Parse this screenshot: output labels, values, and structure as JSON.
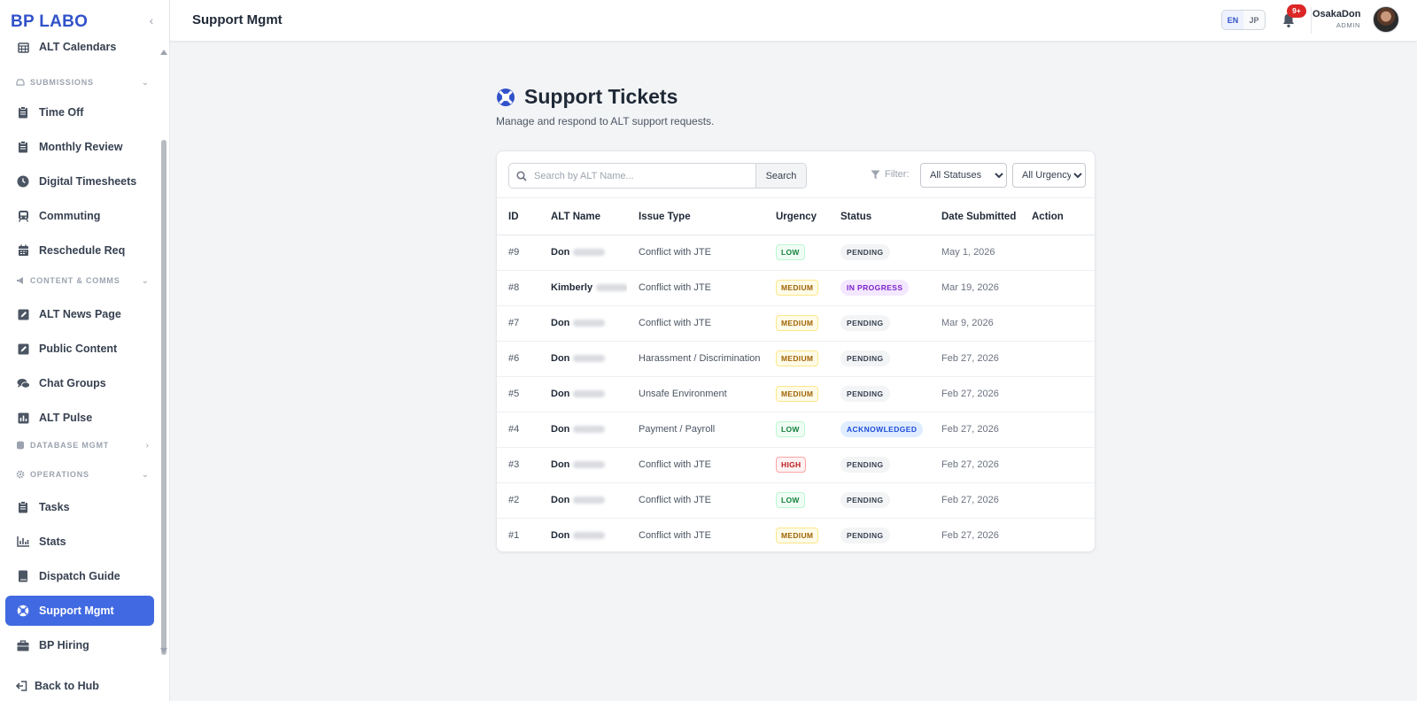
{
  "app": {
    "brand": "BP LABO"
  },
  "sidebar": {
    "partial_top": {
      "label": "ALT Calendars",
      "icon": "calendar-grid-icon"
    },
    "sections": {
      "submissions": "SUBMISSIONS",
      "content": "CONTENT & COMMS",
      "database": "DATABASE MGMT",
      "operations": "OPERATIONS"
    },
    "items": {
      "time_off": "Time Off",
      "monthly_review": "Monthly Review",
      "digital_timesheets": "Digital Timesheets",
      "commuting": "Commuting",
      "reschedule": "Reschedule Req",
      "alt_news": "ALT News Page",
      "public_content": "Public Content",
      "chat_groups": "Chat Groups",
      "alt_pulse": "ALT Pulse",
      "tasks": "Tasks",
      "stats": "Stats",
      "dispatch_guide": "Dispatch Guide",
      "support_mgmt": "Support Mgmt",
      "bp_hiring": "BP Hiring"
    },
    "back": "Back to Hub"
  },
  "header": {
    "title": "Support Mgmt",
    "lang": {
      "en": "EN",
      "jp": "JP",
      "active": "EN"
    },
    "notifications": "9+",
    "user": {
      "name": "OsakaDon",
      "role": "ADMIN"
    }
  },
  "main": {
    "title": "Support Tickets",
    "subtitle": "Manage and respond to ALT support requests.",
    "search": {
      "placeholder": "Search by ALT Name...",
      "button": "Search"
    },
    "filter": {
      "label": "Filter:",
      "status": "All Statuses",
      "urgency": "All Urgency"
    },
    "table": {
      "headers": {
        "id": "ID",
        "name": "ALT Name",
        "issue": "Issue Type",
        "urgency": "Urgency",
        "status": "Status",
        "date": "Date Submitted",
        "action": "Action"
      },
      "rows": [
        {
          "id": "#9",
          "name": "Don",
          "issue": "Conflict with JTE",
          "urgency": "LOW",
          "status": "PENDING",
          "date": "May 1, 2026"
        },
        {
          "id": "#8",
          "name": "Kimberly",
          "issue": "Conflict with JTE",
          "urgency": "MEDIUM",
          "status": "IN PROGRESS",
          "date": "Mar 19, 2026"
        },
        {
          "id": "#7",
          "name": "Don",
          "issue": "Conflict with JTE",
          "urgency": "MEDIUM",
          "status": "PENDING",
          "date": "Mar 9, 2026"
        },
        {
          "id": "#6",
          "name": "Don",
          "issue": "Harassment / Discrimination",
          "urgency": "MEDIUM",
          "status": "PENDING",
          "date": "Feb 27, 2026"
        },
        {
          "id": "#5",
          "name": "Don",
          "issue": "Unsafe Environment",
          "urgency": "MEDIUM",
          "status": "PENDING",
          "date": "Feb 27, 2026"
        },
        {
          "id": "#4",
          "name": "Don",
          "issue": "Payment / Payroll",
          "urgency": "LOW",
          "status": "ACKNOWLEDGED",
          "date": "Feb 27, 2026"
        },
        {
          "id": "#3",
          "name": "Don",
          "issue": "Conflict with JTE",
          "urgency": "HIGH",
          "status": "PENDING",
          "date": "Feb 27, 2026"
        },
        {
          "id": "#2",
          "name": "Don",
          "issue": "Conflict with JTE",
          "urgency": "LOW",
          "status": "PENDING",
          "date": "Feb 27, 2026"
        },
        {
          "id": "#1",
          "name": "Don",
          "issue": "Conflict with JTE",
          "urgency": "MEDIUM",
          "status": "PENDING",
          "date": "Feb 27, 2026"
        }
      ]
    }
  },
  "colors": {
    "brand": "#3152c9",
    "active_nav": "#4169e1",
    "badge": "#dc2626"
  }
}
